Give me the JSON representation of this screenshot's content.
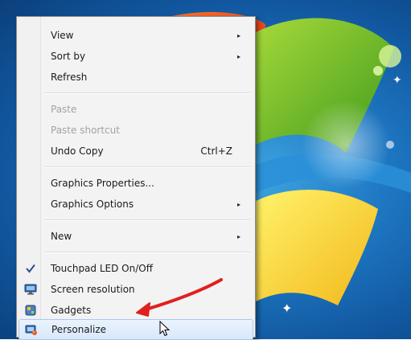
{
  "context_menu": {
    "items": [
      {
        "label": "View",
        "has_submenu": true
      },
      {
        "label": "Sort by",
        "has_submenu": true
      },
      {
        "label": "Refresh"
      },
      {
        "label": "Paste",
        "disabled": true
      },
      {
        "label": "Paste shortcut",
        "disabled": true
      },
      {
        "label": "Undo Copy",
        "shortcut": "Ctrl+Z"
      },
      {
        "label": "Graphics Properties..."
      },
      {
        "label": "Graphics Options",
        "has_submenu": true
      },
      {
        "label": "New",
        "has_submenu": true
      },
      {
        "label": "Touchpad LED On/Off",
        "icon": "checkmark-icon"
      },
      {
        "label": "Screen resolution",
        "icon": "monitor-icon"
      },
      {
        "label": "Gadgets",
        "icon": "gadgets-icon"
      },
      {
        "label": "Personalize",
        "icon": "personalize-icon",
        "hovered": true
      }
    ],
    "submenu_arrow": "▸"
  },
  "annotation": {
    "arrow_color": "#e02020",
    "points_to": "Personalize"
  },
  "desktop": {
    "wallpaper": "windows-7-default",
    "background_color": "#1f79c4"
  }
}
